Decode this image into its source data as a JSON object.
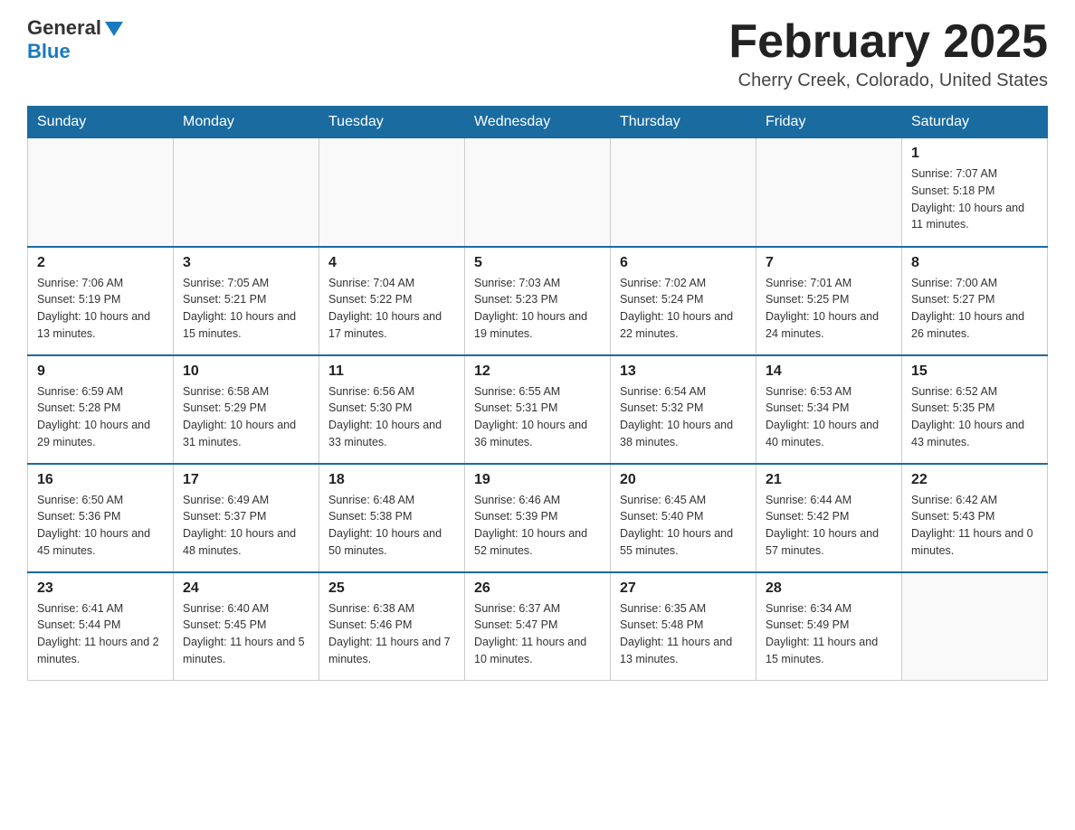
{
  "header": {
    "logo_text": "General",
    "logo_blue": "Blue",
    "month": "February 2025",
    "location": "Cherry Creek, Colorado, United States"
  },
  "days_of_week": [
    "Sunday",
    "Monday",
    "Tuesday",
    "Wednesday",
    "Thursday",
    "Friday",
    "Saturday"
  ],
  "weeks": [
    [
      {
        "day": "",
        "info": ""
      },
      {
        "day": "",
        "info": ""
      },
      {
        "day": "",
        "info": ""
      },
      {
        "day": "",
        "info": ""
      },
      {
        "day": "",
        "info": ""
      },
      {
        "day": "",
        "info": ""
      },
      {
        "day": "1",
        "info": "Sunrise: 7:07 AM\nSunset: 5:18 PM\nDaylight: 10 hours and 11 minutes."
      }
    ],
    [
      {
        "day": "2",
        "info": "Sunrise: 7:06 AM\nSunset: 5:19 PM\nDaylight: 10 hours and 13 minutes."
      },
      {
        "day": "3",
        "info": "Sunrise: 7:05 AM\nSunset: 5:21 PM\nDaylight: 10 hours and 15 minutes."
      },
      {
        "day": "4",
        "info": "Sunrise: 7:04 AM\nSunset: 5:22 PM\nDaylight: 10 hours and 17 minutes."
      },
      {
        "day": "5",
        "info": "Sunrise: 7:03 AM\nSunset: 5:23 PM\nDaylight: 10 hours and 19 minutes."
      },
      {
        "day": "6",
        "info": "Sunrise: 7:02 AM\nSunset: 5:24 PM\nDaylight: 10 hours and 22 minutes."
      },
      {
        "day": "7",
        "info": "Sunrise: 7:01 AM\nSunset: 5:25 PM\nDaylight: 10 hours and 24 minutes."
      },
      {
        "day": "8",
        "info": "Sunrise: 7:00 AM\nSunset: 5:27 PM\nDaylight: 10 hours and 26 minutes."
      }
    ],
    [
      {
        "day": "9",
        "info": "Sunrise: 6:59 AM\nSunset: 5:28 PM\nDaylight: 10 hours and 29 minutes."
      },
      {
        "day": "10",
        "info": "Sunrise: 6:58 AM\nSunset: 5:29 PM\nDaylight: 10 hours and 31 minutes."
      },
      {
        "day": "11",
        "info": "Sunrise: 6:56 AM\nSunset: 5:30 PM\nDaylight: 10 hours and 33 minutes."
      },
      {
        "day": "12",
        "info": "Sunrise: 6:55 AM\nSunset: 5:31 PM\nDaylight: 10 hours and 36 minutes."
      },
      {
        "day": "13",
        "info": "Sunrise: 6:54 AM\nSunset: 5:32 PM\nDaylight: 10 hours and 38 minutes."
      },
      {
        "day": "14",
        "info": "Sunrise: 6:53 AM\nSunset: 5:34 PM\nDaylight: 10 hours and 40 minutes."
      },
      {
        "day": "15",
        "info": "Sunrise: 6:52 AM\nSunset: 5:35 PM\nDaylight: 10 hours and 43 minutes."
      }
    ],
    [
      {
        "day": "16",
        "info": "Sunrise: 6:50 AM\nSunset: 5:36 PM\nDaylight: 10 hours and 45 minutes."
      },
      {
        "day": "17",
        "info": "Sunrise: 6:49 AM\nSunset: 5:37 PM\nDaylight: 10 hours and 48 minutes."
      },
      {
        "day": "18",
        "info": "Sunrise: 6:48 AM\nSunset: 5:38 PM\nDaylight: 10 hours and 50 minutes."
      },
      {
        "day": "19",
        "info": "Sunrise: 6:46 AM\nSunset: 5:39 PM\nDaylight: 10 hours and 52 minutes."
      },
      {
        "day": "20",
        "info": "Sunrise: 6:45 AM\nSunset: 5:40 PM\nDaylight: 10 hours and 55 minutes."
      },
      {
        "day": "21",
        "info": "Sunrise: 6:44 AM\nSunset: 5:42 PM\nDaylight: 10 hours and 57 minutes."
      },
      {
        "day": "22",
        "info": "Sunrise: 6:42 AM\nSunset: 5:43 PM\nDaylight: 11 hours and 0 minutes."
      }
    ],
    [
      {
        "day": "23",
        "info": "Sunrise: 6:41 AM\nSunset: 5:44 PM\nDaylight: 11 hours and 2 minutes."
      },
      {
        "day": "24",
        "info": "Sunrise: 6:40 AM\nSunset: 5:45 PM\nDaylight: 11 hours and 5 minutes."
      },
      {
        "day": "25",
        "info": "Sunrise: 6:38 AM\nSunset: 5:46 PM\nDaylight: 11 hours and 7 minutes."
      },
      {
        "day": "26",
        "info": "Sunrise: 6:37 AM\nSunset: 5:47 PM\nDaylight: 11 hours and 10 minutes."
      },
      {
        "day": "27",
        "info": "Sunrise: 6:35 AM\nSunset: 5:48 PM\nDaylight: 11 hours and 13 minutes."
      },
      {
        "day": "28",
        "info": "Sunrise: 6:34 AM\nSunset: 5:49 PM\nDaylight: 11 hours and 15 minutes."
      },
      {
        "day": "",
        "info": ""
      }
    ]
  ]
}
